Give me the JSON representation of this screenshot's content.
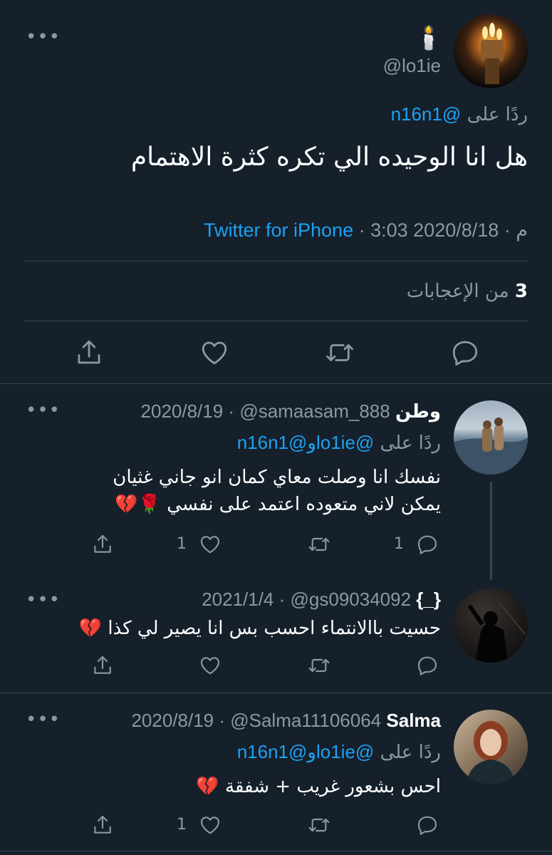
{
  "colors": {
    "background": "#15202b",
    "accent": "#1da1f2",
    "muted": "#8899a6",
    "divider": "#38444d"
  },
  "main_tweet": {
    "emoji": "🕯️",
    "handle": "@lo1ie",
    "reply_prefix": "ردًا على",
    "reply_to": "@n16n1",
    "text": "هل انا الوحيده الي تكره كثرة الاهتمام",
    "date": "2020/8/18",
    "separator1": " · ",
    "time": "3:03 م",
    "separator2": " · ",
    "source": "Twitter for iPhone",
    "likes_count": "3",
    "likes_label": "من الإعجابات"
  },
  "replies": [
    {
      "name": "وطن",
      "handle": "@samaasam_888",
      "date": "2020/8/19",
      "reply_prefix": "ردًا على",
      "reply_to_1": "@lo1ie",
      "reply_and": "و",
      "reply_to_2": "@n16n1",
      "line1": "نفسك انا وصلت معاي كمان انو جاني غثيان",
      "line2": "يمكن لاني متعوده اعتمد على نفسي 🌹💔",
      "reply_count": "1",
      "like_count": "1"
    },
    {
      "name": "{_}",
      "handle": "@gs09034092",
      "date": "2021/1/4",
      "line1": "حسيت باالانتماء احسب بس انا يصير لي كذا 💔"
    },
    {
      "name": "Salma",
      "handle": "@Salma11106064",
      "date": "2020/8/19",
      "reply_prefix": "ردًا على",
      "reply_to_1": "@lo1ie",
      "reply_and": "و",
      "reply_to_2": "@n16n1",
      "line1": "احس بشعور غريب + شفقة 💔",
      "like_count": "1"
    }
  ],
  "icons": {
    "more": "more-horizontal-icon",
    "share": "share-icon",
    "like": "heart-icon",
    "retweet": "retweet-icon",
    "reply": "reply-icon"
  }
}
